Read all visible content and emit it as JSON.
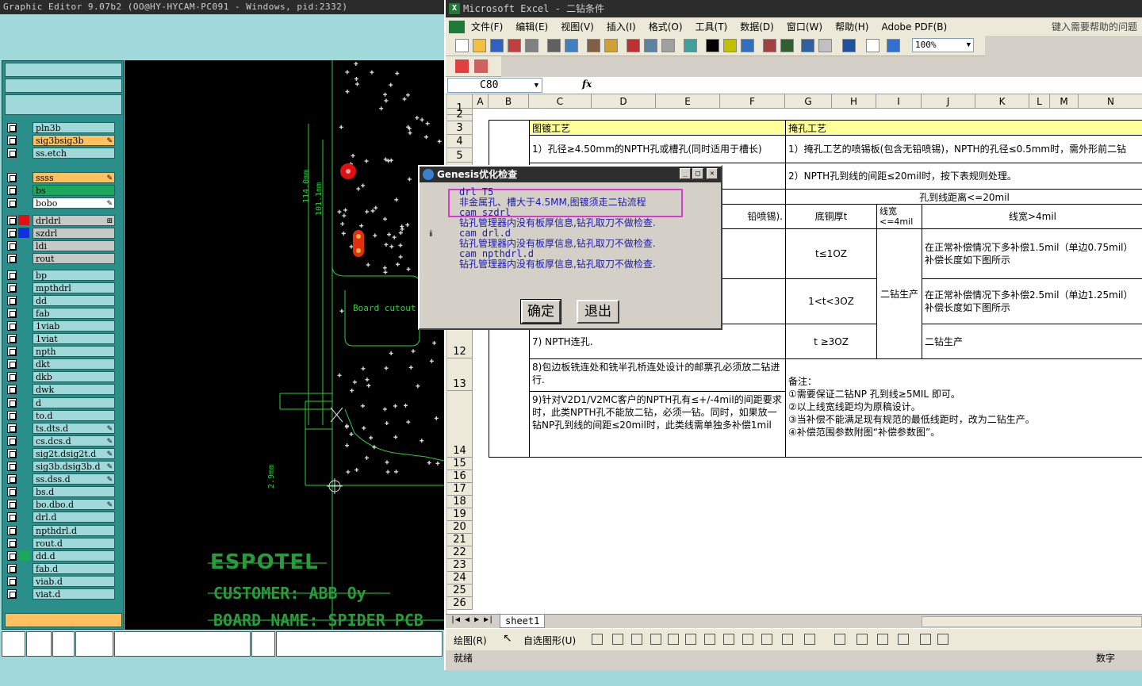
{
  "genesis": {
    "title": "Graphic Editor 9.07b2 (OO@HY-HYCAM-PC091 - Windows, pid:2332)",
    "layers": [
      {
        "name": "pln3b",
        "color": "",
        "style": ""
      },
      {
        "name": "sig3b",
        "color": "",
        "style": "orange",
        "edit": true
      },
      {
        "name": "ss.etch",
        "color": "",
        "style": ""
      },
      {
        "name": "ss",
        "color": "",
        "style": "orange",
        "edit": true
      },
      {
        "name": "bs",
        "color": "",
        "style": "green"
      },
      {
        "name": "bo",
        "color": "",
        "style": "white",
        "edit": true
      },
      {
        "name": "drl",
        "color": "#e01010",
        "style": "gray",
        "board": true
      },
      {
        "name": "szdrl",
        "color": "#1030e0",
        "style": "gray"
      },
      {
        "name": "ldi",
        "color": "",
        "style": "gray"
      },
      {
        "name": "rout",
        "color": "",
        "style": "gray"
      },
      {
        "name": "bp",
        "color": "",
        "style": ""
      },
      {
        "name": "mpthdrl",
        "color": "",
        "style": ""
      },
      {
        "name": "dd",
        "color": "",
        "style": ""
      },
      {
        "name": "fab",
        "color": "",
        "style": ""
      },
      {
        "name": "1viab",
        "color": "",
        "style": ""
      },
      {
        "name": "1viat",
        "color": "",
        "style": ""
      },
      {
        "name": "npth",
        "color": "",
        "style": ""
      },
      {
        "name": "dkt",
        "color": "",
        "style": ""
      },
      {
        "name": "dkb",
        "color": "",
        "style": ""
      },
      {
        "name": "dwk",
        "color": "",
        "style": ""
      },
      {
        "name": "d",
        "color": "",
        "style": ""
      },
      {
        "name": "to.d",
        "color": "",
        "style": ""
      },
      {
        "name": "ts.d",
        "color": "",
        "style": "",
        "edit": true
      },
      {
        "name": "cs.d",
        "color": "",
        "style": "",
        "edit": true
      },
      {
        "name": "sig2t.d",
        "color": "",
        "style": "",
        "edit": true
      },
      {
        "name": "sig3b.d",
        "color": "",
        "style": "",
        "edit": true
      },
      {
        "name": "ss.d",
        "color": "",
        "style": "",
        "edit": true
      },
      {
        "name": "bs.d",
        "color": "",
        "style": ""
      },
      {
        "name": "bo.d",
        "color": "",
        "style": "",
        "edit": true
      },
      {
        "name": "drl.d",
        "color": "",
        "style": ""
      },
      {
        "name": "npthdrl.d",
        "color": "",
        "style": ""
      },
      {
        "name": "rout.d",
        "color": "",
        "style": ""
      },
      {
        "name": "dd.d",
        "color": "#1ba85a",
        "style": ""
      },
      {
        "name": "fab.d",
        "color": "",
        "style": ""
      },
      {
        "name": "viab.d",
        "color": "",
        "style": ""
      },
      {
        "name": "viat.d",
        "color": "",
        "style": ""
      }
    ],
    "canvas": {
      "dim1": "114.0mm",
      "dim2": "101.1mm",
      "dim3": "2.9mm",
      "cutout": "Board cutout",
      "brand": "ESPOTEL",
      "customer": "CUSTOMER: ABB Oy",
      "board": "BOARD NAME: SPIDER PCB"
    }
  },
  "excel": {
    "title": "Microsoft Excel - 二钻条件",
    "menus": [
      "文件(F)",
      "编辑(E)",
      "视图(V)",
      "插入(I)",
      "格式(O)",
      "工具(T)",
      "数据(D)",
      "窗口(W)",
      "帮助(H)",
      "Adobe PDF(B)"
    ],
    "help_placeholder": "键入需要帮助的问题",
    "zoom": "100%",
    "namebox": "C80",
    "fx": "fx",
    "columns": [
      "A",
      "B",
      "C",
      "D",
      "E",
      "F",
      "G",
      "H",
      "I",
      "J",
      "K",
      "L",
      "M",
      "N"
    ],
    "rows": [
      "1",
      "2",
      "3",
      "4",
      "5",
      "12",
      "13",
      "14",
      "15",
      "16",
      "17",
      "18",
      "19",
      "20",
      "21",
      "22",
      "23",
      "24",
      "25",
      "26"
    ],
    "cells": {
      "c3": "图镀工艺",
      "g3": "掩孔工艺",
      "c4": "1）孔径≥4.50mm的NPTH孔或槽孔(同时适用于槽长)",
      "g4": "1）掩孔工艺的喷锡板(包含无铅喷锡)，NPTH的孔径≤0.5mm时，需外形前二钻",
      "g6": "2）NPTH孔到线的间距≤20mil时，按下表规则处理。",
      "h7": "孔到线距离<=20mil",
      "e8": "铅喷锡).",
      "g8": "底铜厚t",
      "i8": "线宽<=4mil",
      "j8": "线宽>4mil",
      "g9": "t≤1OZ",
      "i9": "二钻生产",
      "j9": "在正常补偿情况下多补偿1.5mil（单边0.75mil）补偿长度如下图所示",
      "g10": "1<t<3OZ",
      "j10": "在正常补偿情况下多补偿2.5mil（单边1.25mil）补偿长度如下图所示",
      "c11": "7) NPTH连孔.",
      "g11": "t ≥3OZ",
      "j11": "二钻生产",
      "c13": "8)包边板铣连处和铣半孔桥连处设计的邮票孔必须放二钻进行.",
      "c14": "9)针对V2D1/V2MC客户的NPTH孔有≤+/-4mil的间距要求时，此类NPTH孔不能放二钻，必须一钻。同时，如果放一钻NP孔到线的间距≤20mil时，此类线需单独多补偿1mil",
      "g13": "备注：\n①需要保证二钻NP 孔到线≥5MIL 即可。\n②以上线宽线距均为原稿设计。\n③当补偿不能满足现有规范的最低线距时，改为二钻生产。\n④补偿范围参数附图“补偿参数图”。"
    },
    "sheet_tab": "sheet1",
    "draw_label": "绘图(R)",
    "autoshape_label": "自选图形(U)",
    "status_ready": "就绪",
    "status_num": "数字"
  },
  "dialog": {
    "title": "Genesis优化检查",
    "lines": [
      "drl T5",
      "非金属孔、槽大于4.5MM,图镀须走二钻流程",
      "cam szdrl",
      "钻孔管理器内没有板厚信息,钻孔取刀不做检查.",
      "cam drl.d",
      "钻孔管理器内没有板厚信息,钻孔取刀不做检查.",
      "cam npthdrl.d",
      "钻孔管理器内没有板厚信息,钻孔取刀不做检查."
    ],
    "ok": "确定",
    "exit": "退出"
  }
}
